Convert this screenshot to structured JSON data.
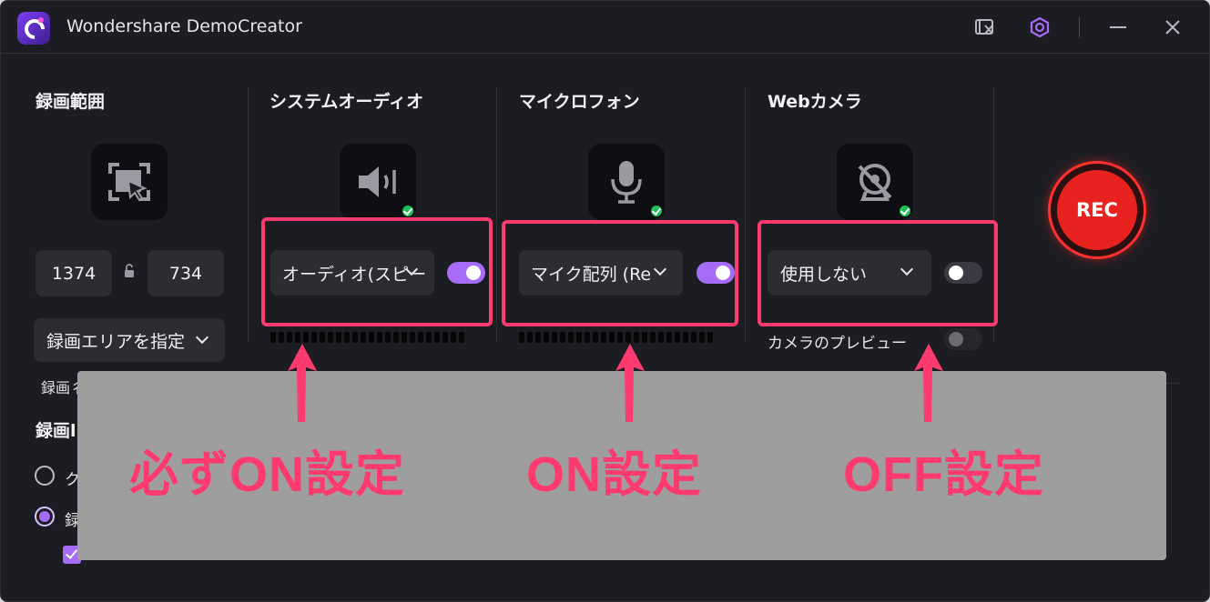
{
  "app": {
    "title": "Wondershare DemoCreator"
  },
  "titlebar_icons": [
    "screen-clip-icon",
    "settings-hexagon-icon",
    "minimize-icon",
    "close-icon"
  ],
  "sections": {
    "area": {
      "title": "録画範囲",
      "width": "1374",
      "height": "734",
      "dropdown": "録画エリアを指定",
      "subtext": "録画彳"
    },
    "system_audio": {
      "title": "システムオーディオ",
      "dropdown": "オーディオ(スピー",
      "toggle_on": true
    },
    "microphone": {
      "title": "マイクロフォン",
      "dropdown": "マイク配列 (Re",
      "toggle_on": true
    },
    "webcam": {
      "title": "Webカメラ",
      "dropdown": "使用しない",
      "toggle_on": false,
      "preview_label": "カメラのプレビュー",
      "preview_on": false
    }
  },
  "rec": {
    "label": "REC"
  },
  "options": {
    "heading": "録画l",
    "radio1": "ク",
    "radio2": "録"
  },
  "annotations": {
    "left": "必ずON設定",
    "middle": "ON設定",
    "right": "OFF設定"
  },
  "colors": {
    "accent": "#a56cf7",
    "highlight": "#ff3a6e",
    "rec": "#e8231f",
    "check": "#1fc05a",
    "overlay": "#9e9e9e"
  }
}
